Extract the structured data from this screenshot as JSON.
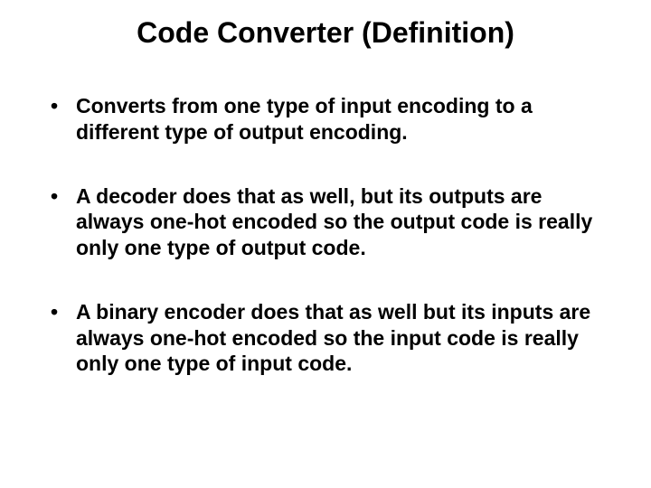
{
  "title": "Code Converter (Definition)",
  "bullets": [
    "Converts from one type of input encoding  to a different type of output encoding.",
    "A decoder does that as well, but its outputs are always one-hot encoded so the output code is really only one type of output code.",
    "A binary encoder does that as well but its inputs are always one-hot encoded so the input code is really only one type of input code."
  ]
}
